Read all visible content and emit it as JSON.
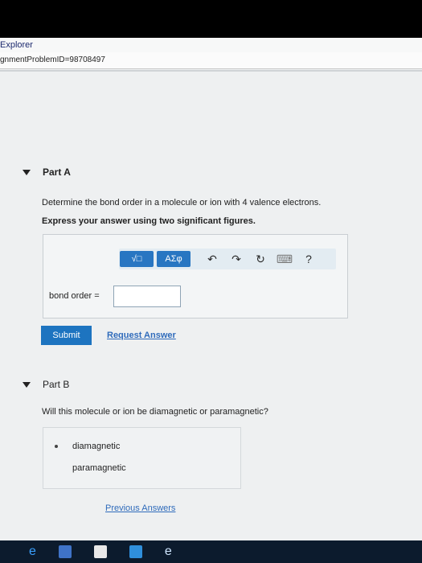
{
  "browser": {
    "title": "Explorer",
    "address": "gnmentProblemID=98708497"
  },
  "part_a": {
    "label": "Part A",
    "question": "Determine the bond order in a molecule or ion with 4 valence electrons.",
    "instruction": "Express your answer using two significant figures.",
    "toolbar": {
      "math_label": "√□",
      "greek_label": "ΑΣφ",
      "undo_icon": "↶",
      "redo_icon": "↷",
      "reset_icon": "↻",
      "keyboard_icon": "⌨",
      "help_label": "?"
    },
    "input_label": "bond order =",
    "input_value": "",
    "submit_label": "Submit",
    "request_label": "Request Answer"
  },
  "part_b": {
    "label": "Part B",
    "question": "Will this molecule or ion be diamagnetic or paramagnetic?",
    "options": [
      "diamagnetic",
      "paramagnetic"
    ],
    "selected": "diamagnetic",
    "previous_label": "Previous Answers"
  },
  "colors": {
    "accent": "#1d74c0",
    "link": "#2f6bbb",
    "page_bg": "#eef0f1"
  }
}
